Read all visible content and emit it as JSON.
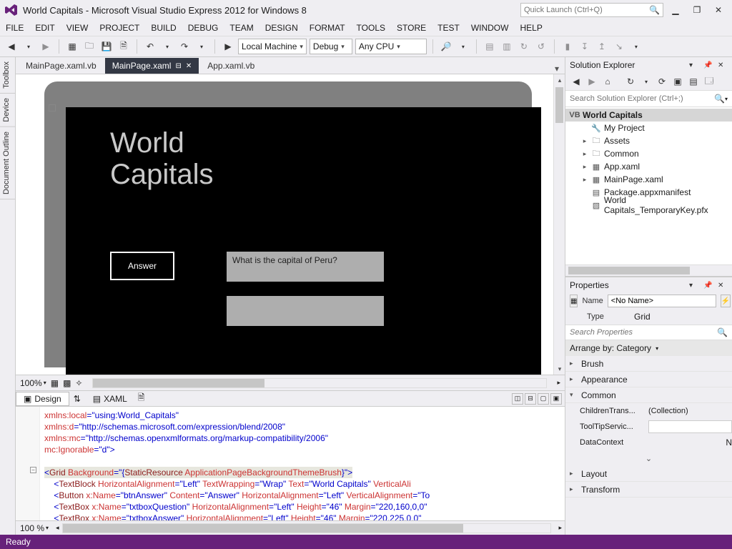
{
  "title": "World Capitals - Microsoft Visual Studio Express 2012 for Windows 8",
  "quicklaunch_placeholder": "Quick Launch (Ctrl+Q)",
  "menus": [
    "FILE",
    "EDIT",
    "VIEW",
    "PROJECT",
    "BUILD",
    "DEBUG",
    "TEAM",
    "DESIGN",
    "FORMAT",
    "TOOLS",
    "STORE",
    "TEST",
    "WINDOW",
    "HELP"
  ],
  "toolbar": {
    "run_target": "Local Machine",
    "config": "Debug",
    "platform": "Any CPU"
  },
  "tabs": {
    "inactive1": "MainPage.xaml.vb",
    "active": "MainPage.xaml",
    "inactive2": "App.xaml.vb"
  },
  "side_strips": [
    "Toolbox",
    "Device",
    "Document Outline"
  ],
  "designer": {
    "app_title": "World\nCapitals",
    "answer_button": "Answer",
    "question_text": "What is the capital of Peru?",
    "zoom": "100%",
    "code_zoom": "100 %",
    "design_tab": "Design",
    "xaml_tab": "XAML"
  },
  "code_lines": {
    "l1a": "xmlns:",
    "l1b": "local",
    "l1c": "=",
    "l1d": "\"using:World_Capitals\"",
    "l2a": "xmlns:",
    "l2b": "d",
    "l2c": "=",
    "l2d": "\"http://schemas.microsoft.com/expression/blend/2008\"",
    "l3a": "xmlns:",
    "l3b": "mc",
    "l3c": "=",
    "l3d": "\"http://schemas.openxmlformats.org/markup-compatibility/2006\"",
    "l4a": "mc:",
    "l4b": "Ignorable",
    "l4c": "=",
    "l4d": "\"d\"",
    "l4e": ">",
    "l6a": "<",
    "l6b": "Grid",
    "l6c": " Background",
    "l6d": "=",
    "l6e": "\"{",
    "l6f": "StaticResource",
    "l6g": " ApplicationPageBackgroundThemeBrush",
    "l6h": "}\"",
    "l6i": ">",
    "l7a": "<",
    "l7b": "TextBlock",
    "l7c": " HorizontalAlignment",
    "l7d": "=",
    "l7e": "\"Left\"",
    "l7f": " TextWrapping",
    "l7g": "=",
    "l7h": "\"Wrap\"",
    "l7i": " Text",
    "l7j": "=",
    "l7k": "\"World Capitals\"",
    "l7l": " VerticalAli",
    "l8a": "<",
    "l8b": "Button",
    "l8c": " x:",
    "l8d": "Name",
    "l8e": "=",
    "l8f": "\"btnAnswer\"",
    "l8g": " Content",
    "l8h": "=",
    "l8i": "\"Answer\"",
    "l8j": " HorizontalAlignment",
    "l8k": "=",
    "l8l": "\"Left\"",
    "l8m": " VerticalAlignment",
    "l8n": "=",
    "l8o": "\"To",
    "l9a": "<",
    "l9b": "TextBox",
    "l9c": " x:",
    "l9d": "Name",
    "l9e": "=",
    "l9f": "\"txtboxQuestion\"",
    "l9g": " HorizontalAlignment",
    "l9h": "=",
    "l9i": "\"Left\"",
    "l9j": " Height",
    "l9k": "=",
    "l9l": "\"46\"",
    "l9m": " Margin",
    "l9n": "=",
    "l9o": "\"220,160,0,0\"",
    "l10a": "<",
    "l10b": "TextBox",
    "l10c": " x:",
    "l10d": "Name",
    "l10e": "=",
    "l10f": "\"txtboxAnswer\"",
    "l10g": " HorizontalAlignment",
    "l10h": "=",
    "l10i": "\"Left\"",
    "l10j": " Height",
    "l10k": "=",
    "l10l": "\"46\"",
    "l10m": " Margin",
    "l10n": "=",
    "l10o": "\"220,225,0,0\""
  },
  "solution_explorer": {
    "title": "Solution Explorer",
    "search_placeholder": "Search Solution Explorer (Ctrl+;)",
    "root": "World Capitals",
    "items": [
      "My Project",
      "Assets",
      "Common",
      "App.xaml",
      "MainPage.xaml",
      "Package.appxmanifest",
      "World Capitals_TemporaryKey.pfx"
    ]
  },
  "properties": {
    "title": "Properties",
    "name_label": "Name",
    "name_value": "<No Name>",
    "type_label": "Type",
    "type_value": "Grid",
    "search_placeholder": "Search Properties",
    "arrange_label": "Arrange by: Category",
    "cats": [
      "Brush",
      "Appearance",
      "Common",
      "Layout",
      "Transform"
    ],
    "children_label": "ChildrenTrans...",
    "children_val": "(Collection)",
    "tooltip_label": "ToolTipServic...",
    "datacontext_label": "DataContext",
    "datacontext_btn": "N"
  },
  "status": "Ready"
}
